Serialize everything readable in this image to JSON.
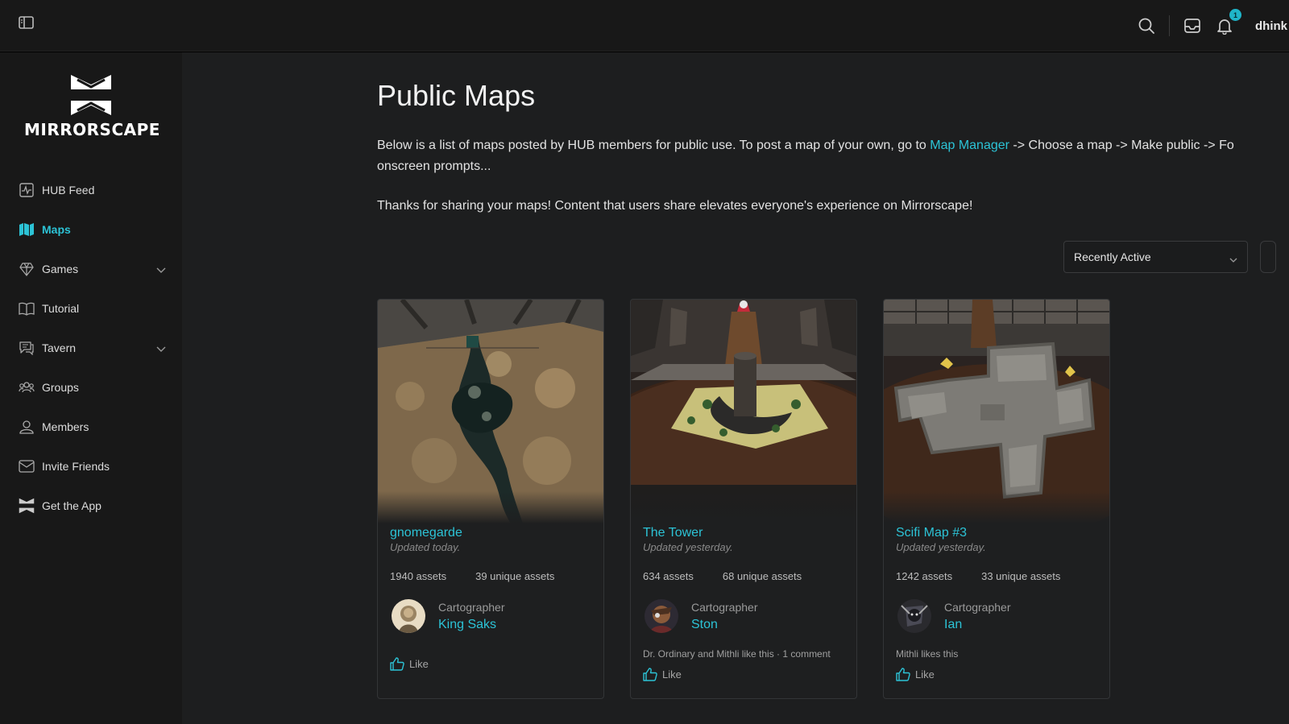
{
  "topbar": {
    "username": "dhink",
    "notification_count": "1"
  },
  "sidebar": {
    "logo_text": "MIRRORSCAPE",
    "items": [
      {
        "label": "HUB Feed",
        "icon": "activity-icon"
      },
      {
        "label": "Maps",
        "icon": "map-icon",
        "active": true
      },
      {
        "label": "Games",
        "icon": "diamond-icon",
        "has_children": true
      },
      {
        "label": "Tutorial",
        "icon": "book-icon"
      },
      {
        "label": "Tavern",
        "icon": "chat-icon",
        "has_children": true
      },
      {
        "label": "Groups",
        "icon": "group-icon"
      },
      {
        "label": "Members",
        "icon": "user-icon"
      },
      {
        "label": "Invite Friends",
        "icon": "mail-icon"
      },
      {
        "label": "Get the App",
        "icon": "mirrorscape-logo-icon"
      }
    ]
  },
  "page": {
    "title": "Public Maps",
    "intro_before_link": "Below is a list of maps posted by HUB members for public use. To post a map of your own, go to ",
    "intro_link": "Map Manager",
    "intro_after_link": " -> Choose a map -> Make public -> Fo",
    "intro_line2": "onscreen prompts...",
    "thanks": "Thanks for sharing your maps! Content that users share elevates everyone's experience on Mirrorscape!",
    "sort_selected": "Recently Active"
  },
  "cards": [
    {
      "title": "gnomegarde",
      "updated": "Updated today.",
      "assets": "1940 assets",
      "unique_assets": "39 unique assets",
      "author_role": "Cartographer",
      "author_name": "King Saks",
      "likes_text": "",
      "like_label": "Like"
    },
    {
      "title": "The Tower",
      "updated": "Updated yesterday.",
      "assets": "634 assets",
      "unique_assets": "68 unique assets",
      "author_role": "Cartographer",
      "author_name": "Ston",
      "likes_text": "Dr. Ordinary and Mithli like this · 1 comment",
      "like_label": "Like"
    },
    {
      "title": "Scifi Map #3",
      "updated": "Updated yesterday.",
      "assets": "1242 assets",
      "unique_assets": "33 unique assets",
      "author_role": "Cartographer",
      "author_name": "Ian",
      "likes_text": "Mithli likes this",
      "like_label": "Like"
    }
  ],
  "colors": {
    "accent": "#2cc3d6",
    "background": "#1d1e1f",
    "sidebar": "#181818"
  }
}
